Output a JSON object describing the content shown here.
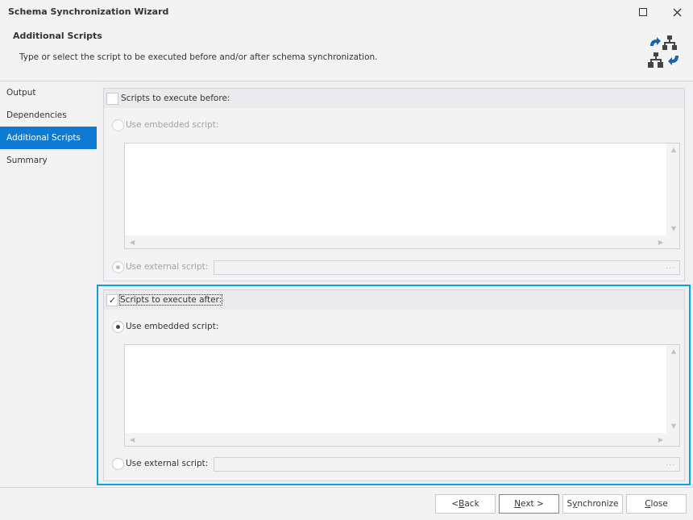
{
  "window": {
    "title": "Schema Synchronization Wizard"
  },
  "header": {
    "title": "Additional Scripts",
    "description": "Type or select the script to be executed before and/or after schema synchronization.",
    "icon": "schema-sync-icon"
  },
  "sidebar": {
    "items": [
      {
        "label": "Output",
        "active": false
      },
      {
        "label": "Dependencies",
        "active": false
      },
      {
        "label": "Additional Scripts",
        "active": true
      },
      {
        "label": "Summary",
        "active": false
      }
    ]
  },
  "before": {
    "checkbox_label": "Scripts to execute before:",
    "checked": false,
    "embedded_label": "Use embedded script:",
    "embedded_selected": false,
    "embedded_value": "",
    "external_label": "Use external script:",
    "external_selected": true,
    "external_value": "",
    "browse_label": "..."
  },
  "after": {
    "checkbox_label": "Scripts to execute after:",
    "checked": true,
    "check_glyph": "✓",
    "embedded_label": "Use embedded script:",
    "embedded_selected": true,
    "embedded_value": "",
    "external_label": "Use external script:",
    "external_selected": false,
    "external_value": "",
    "browse_label": "..."
  },
  "footer": {
    "back": {
      "prefix": "< ",
      "mnemonic": "B",
      "rest": "ack"
    },
    "next": {
      "mnemonic": "N",
      "rest": "ext >"
    },
    "sync": {
      "prefix": "S",
      "mnemonic": "y",
      "rest": "nchronize"
    },
    "close": {
      "mnemonic": "C",
      "rest": "lose"
    }
  }
}
